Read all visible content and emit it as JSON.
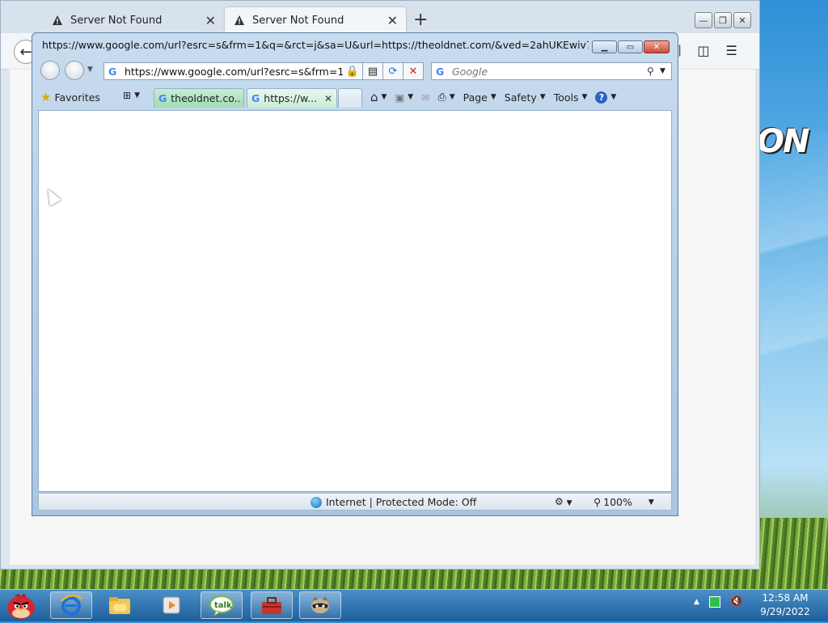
{
  "firefox": {
    "tabs": [
      {
        "label": "Server Not Found",
        "active": false
      },
      {
        "label": "Server Not Found",
        "active": true
      }
    ],
    "new_tab": "+",
    "back": "←"
  },
  "ie": {
    "title": "https://www.google.com/url?esrc=s&frm=1&q=&rct=j&sa=U&url=https://theoldnet.com/&ved=2ahUKEwiv7 - ...",
    "address": "https://www.google.com/url?esrc=s&frm=1",
    "search_placeholder": "Google",
    "favorites_label": "Favorites",
    "tabs": [
      {
        "label": "theoldnet.co..."
      },
      {
        "label": "https://w..."
      }
    ],
    "toolbar": {
      "page": "Page",
      "safety": "Safety",
      "tools": "Tools"
    },
    "status": {
      "zone": "Internet | Protected Mode: Off",
      "zoom": "100%"
    }
  },
  "taskbar": {
    "time": "12:58 AM",
    "date": "9/29/2022",
    "apps": [
      "start-angry-bird",
      "internet-explorer",
      "folder",
      "media-player",
      "talk",
      "toolbox",
      "raccoon"
    ]
  },
  "desktop": {
    "logo_text": "ON"
  },
  "colors": {
    "taskbar": "#2a6fae",
    "ie_frame": "#b6cfe7"
  }
}
